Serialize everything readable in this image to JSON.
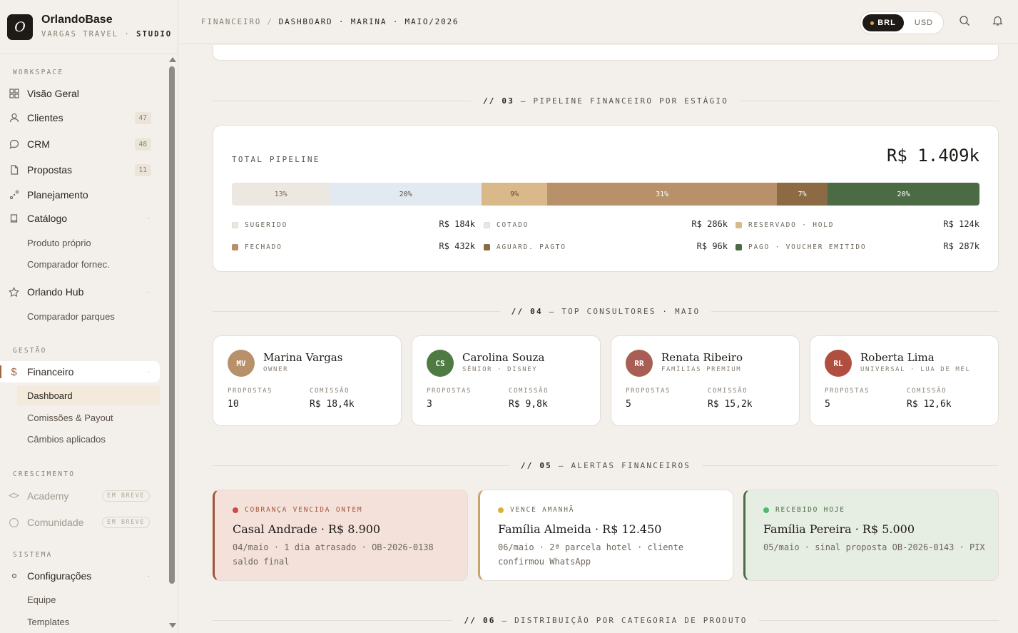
{
  "brand": {
    "logo_letter": "O",
    "name": "OrlandoBase",
    "sub_a": "VARGAS TRAVEL · ",
    "sub_b": "STUDIO"
  },
  "sidebar": {
    "workspace_label": "WORKSPACE",
    "visao": "Visão Geral",
    "clientes": "Clientes",
    "clientes_count": "47",
    "crm": "CRM",
    "crm_count": "48",
    "propostas": "Propostas",
    "propostas_count": "11",
    "planejamento": "Planejamento",
    "catalogo": "Catálogo",
    "produto_proprio": "Produto próprio",
    "comparador_fornec": "Comparador fornec.",
    "orlando_hub": "Orlando Hub",
    "comparador_parques": "Comparador parques",
    "gestao_label": "GESTÃO",
    "financeiro": "Financeiro",
    "dashboard": "Dashboard",
    "comissoes": "Comissões & Payout",
    "cambios": "Câmbios aplicados",
    "crescimento_label": "CRESCIMENTO",
    "academy": "Academy",
    "comunidade": "Comunidade",
    "em_breve": "EM BREVE",
    "sistema_label": "SISTEMA",
    "configuracoes": "Configurações",
    "equipe": "Equipe",
    "templates": "Templates"
  },
  "topbar": {
    "crumb_1": "FINANCEIRO",
    "crumb_sep": "/",
    "crumb_2": "DASHBOARD · MARINA · MAIO/2026",
    "cur_brl": "BRL",
    "cur_usd": "USD"
  },
  "sections": {
    "s03_num": "// 03",
    "s03_title": " — PIPELINE FINANCEIRO POR ESTÁGIO",
    "s04_num": "// 04",
    "s04_title": " — TOP CONSULTORES · MAIO",
    "s05_num": "// 05",
    "s05_title": " — ALERTAS FINANCEIROS",
    "s06_num": "// 06",
    "s06_title": " — DISTRIBUIÇÃO POR CATEGORIA DE PRODUTO"
  },
  "pipeline": {
    "label": "TOTAL PIPELINE",
    "total": "R$ 1.409k",
    "segments": [
      {
        "pct_label": "13%",
        "share": 13.1,
        "color": "#ece7e0",
        "text_color": "#6e665c"
      },
      {
        "pct_label": "20%",
        "share": 20.3,
        "color": "#e3e9f0",
        "text_color": "#5a5249"
      },
      {
        "pct_label": "9%",
        "share": 8.8,
        "color": "#d9b98a",
        "text_color": "#5a4a35"
      },
      {
        "pct_label": "31%",
        "share": 30.7,
        "color": "#b8916a",
        "text_color": "#ffffff"
      },
      {
        "pct_label": "7%",
        "share": 6.8,
        "color": "#8b6a44",
        "text_color": "#ffffff"
      },
      {
        "pct_label": "20%",
        "share": 20.3,
        "color": "#4b6b45",
        "text_color": "#ffffff"
      }
    ],
    "legend": [
      {
        "name": "SUGERIDO",
        "value": "R$ 184k",
        "color": "#ece7e0"
      },
      {
        "name": "COTADO",
        "value": "R$ 286k",
        "color": "#e3e9f0"
      },
      {
        "name": "RESERVADO · HOLD",
        "value": "R$ 124k",
        "color": "#d9b98a"
      },
      {
        "name": "FECHADO",
        "value": "R$ 432k",
        "color": "#b8916a"
      },
      {
        "name": "AGUARD. PAGTO",
        "value": "R$ 96k",
        "color": "#8b6a44"
      },
      {
        "name": "PAGO · VOUCHER EMITIDO",
        "value": "R$ 287k",
        "color": "#4b6b45"
      }
    ]
  },
  "consultores": [
    {
      "initials": "MV",
      "name": "Marina Vargas",
      "role": "OWNER",
      "propostas_label": "PROPOSTAS",
      "propostas": "10",
      "comissao_label": "COMISSÃO",
      "comissao": "R$ 18,4k",
      "color": "#b8916a"
    },
    {
      "initials": "CS",
      "name": "Carolina Souza",
      "role": "SÊNIOR · DISNEY",
      "propostas_label": "PROPOSTAS",
      "propostas": "3",
      "comissao_label": "COMISSÃO",
      "comissao": "R$ 9,8k",
      "color": "#4f7a42"
    },
    {
      "initials": "RR",
      "name": "Renata Ribeiro",
      "role": "FAMÍLIAS PREMIUM",
      "propostas_label": "PROPOSTAS",
      "propostas": "5",
      "comissao_label": "COMISSÃO",
      "comissao": "R$ 15,2k",
      "color": "#a85e55"
    },
    {
      "initials": "RL",
      "name": "Roberta Lima",
      "role": "UNIVERSAL · LUA DE MEL",
      "propostas_label": "PROPOSTAS",
      "propostas": "5",
      "comissao_label": "COMISSÃO",
      "comissao": "R$ 12,6k",
      "color": "#b04f3f"
    }
  ],
  "alertas": [
    {
      "tag": "COBRANÇA VENCIDA ONTEM",
      "title": "Casal Andrade · R$ 8.900",
      "desc": "04/maio · 1 dia atrasado · OB-2026-0138 saldo final",
      "bg": "#f4e2da",
      "border": "#a3533b",
      "dot": "#d04848",
      "tag_color": "#a3533b"
    },
    {
      "tag": "VENCE AMANHÃ",
      "title": "Família Almeida · R$ 12.450",
      "desc": "06/maio · 2ª parcela hotel · cliente confirmou WhatsApp",
      "bg": "#ffffff",
      "border": "#c7a46b",
      "dot": "#d8b23c",
      "tag_color": "#6e665c"
    },
    {
      "tag": "RECEBIDO HOJE",
      "title": "Família Pereira · R$ 5.000",
      "desc": "05/maio · sinal proposta OB-2026-0143 · PIX",
      "bg": "#e6ede3",
      "border": "#4b6b45",
      "dot": "#4dbb6a",
      "tag_color": "#4b6b45"
    }
  ]
}
